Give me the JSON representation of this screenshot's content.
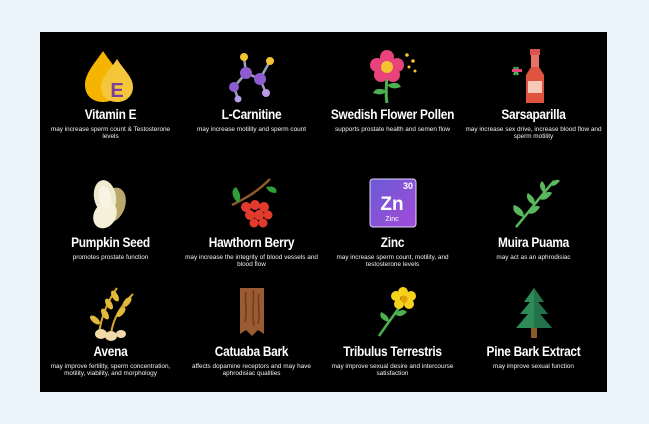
{
  "items": [
    {
      "name": "Vitamin E",
      "desc": "may increase sperm count & Testosterone levels",
      "icon": "vitamin-e-drop-icon",
      "badge": "E"
    },
    {
      "name": "L-Carnitine",
      "desc": "may increase motility and sperm count",
      "icon": "molecule-icon"
    },
    {
      "name": "Swedish Flower Pollen",
      "desc": "supports prostate health and semen flow",
      "icon": "flower-pollen-icon"
    },
    {
      "name": "Sarsaparilla",
      "desc": "may increase sex drive, increase blood flow and sperm motility",
      "icon": "bottle-icon"
    },
    {
      "name": "Pumpkin Seed",
      "desc": "promotes prostate function",
      "icon": "pumpkin-seed-icon"
    },
    {
      "name": "Hawthorn Berry",
      "desc": "may increase the integrity of blood vessels and blood flow",
      "icon": "berry-branch-icon"
    },
    {
      "name": "Zinc",
      "desc": "may increase sperm count, motility, and testosterone levels",
      "icon": "zinc-element-icon",
      "element": {
        "symbol": "Zn",
        "number": "30",
        "label": "Zinc"
      }
    },
    {
      "name": "Muira Puama",
      "desc": "may act as an aphrodisiac",
      "icon": "leaf-branch-icon"
    },
    {
      "name": "Avena",
      "desc": "may improve fertility, sperm concentration, motility, viability, and morphology",
      "icon": "oat-icon"
    },
    {
      "name": "Catuaba Bark",
      "desc": "affects dopamine receptors and may have aphrodisiac qualities",
      "icon": "bark-icon"
    },
    {
      "name": "Tribulus Terrestris",
      "desc": "may improve sexual desire and intercourse satisfaction",
      "icon": "yellow-flower-icon"
    },
    {
      "name": "Pine Bark Extract",
      "desc": "may improve sexual function",
      "icon": "pine-tree-icon"
    }
  ]
}
